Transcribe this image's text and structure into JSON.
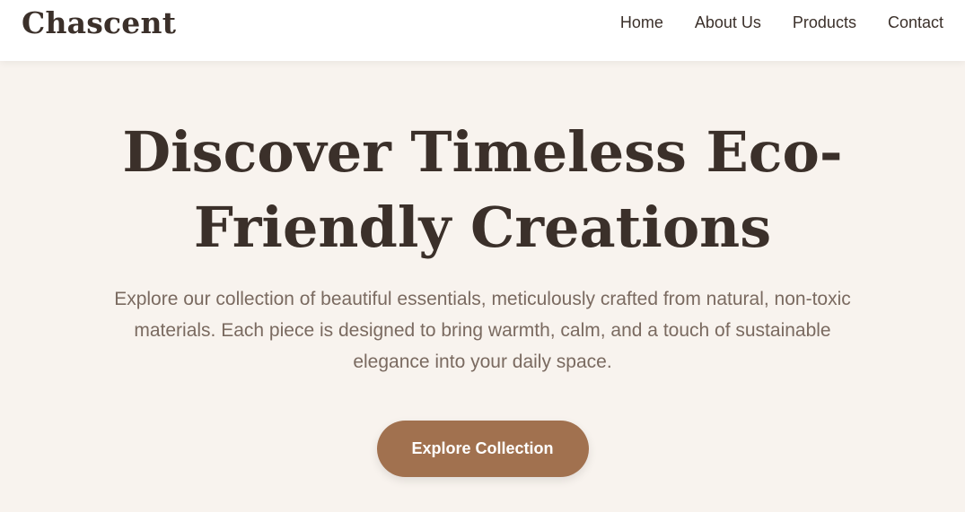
{
  "header": {
    "logo": "Chascent",
    "nav": [
      "Home",
      "About Us",
      "Products",
      "Contact"
    ]
  },
  "hero": {
    "title": "Discover Timeless Eco-Friendly Creations",
    "description": "Explore our collection of beautiful essentials, meticulously crafted from natural, non-toxic materials. Each piece is designed to bring warmth, calm, and a touch of sustainable elegance into your daily space.",
    "cta": "Explore Collection"
  },
  "colors": {
    "background": "#f8f3ee",
    "header": "#ffffff",
    "text": "#3b302a",
    "muted": "#7a6a60",
    "accent": "#a1714f"
  }
}
